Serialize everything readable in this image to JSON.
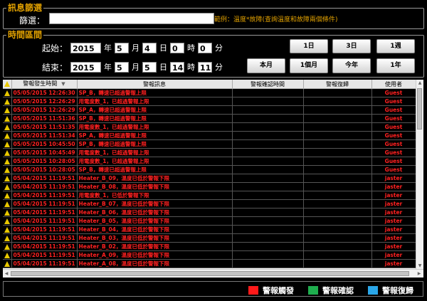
{
  "filter": {
    "title": "訊息篩選",
    "label": "篩選：",
    "value": "",
    "hint": "範例：溫度*故障(查詢溫度和故障兩個條件)"
  },
  "time": {
    "title": "時間區間",
    "start": {
      "label": "起始：",
      "year": "2015",
      "month": "5",
      "day": "4",
      "hour": "0",
      "minute": "0"
    },
    "end": {
      "label": "結束：",
      "year": "2015",
      "month": "5",
      "day": "5",
      "hour": "14",
      "minute": "11"
    },
    "units": {
      "year": "年",
      "month": "月",
      "day": "日",
      "hour": "時",
      "minute": "分"
    },
    "buttons": [
      "1日",
      "3日",
      "1週",
      "本月",
      "1個月",
      "今年",
      "1年"
    ]
  },
  "table": {
    "columns": [
      "",
      "警報發生時間",
      "警報訊息",
      "警報確認時間",
      "警報復歸",
      "使用者"
    ],
    "rows": [
      [
        "05/05/2015 12:26:30",
        "SP_B，轉速已超過警報上限",
        "",
        "",
        "Guest"
      ],
      [
        "05/05/2015 12:26:29",
        "用電度數_1，已超過警報上限",
        "",
        "",
        "Guest"
      ],
      [
        "05/05/2015 12:26:29",
        "SP_A，轉速已超過警報上限",
        "",
        "",
        "Guest"
      ],
      [
        "05/05/2015 11:51:36",
        "SP_B，轉速已超過警報上限",
        "",
        "",
        "Guest"
      ],
      [
        "05/05/2015 11:51:35",
        "用電度數_1，已超過警報上限",
        "",
        "",
        "Guest"
      ],
      [
        "05/05/2015 11:51:34",
        "SP_A，轉速已超過警報上限",
        "",
        "",
        "Guest"
      ],
      [
        "05/05/2015 10:45:50",
        "SP_B，轉速已超過警報上限",
        "",
        "",
        "Guest"
      ],
      [
        "05/05/2015 10:45:49",
        "用電度數_1，已超過警報上限",
        "",
        "",
        "Guest"
      ],
      [
        "05/05/2015 10:28:05",
        "用電度數_1，已超過警報上限",
        "",
        "",
        "Guest"
      ],
      [
        "05/05/2015 10:28:05",
        "SP_B，轉速已超過警報上限",
        "",
        "",
        "Guest"
      ],
      [
        "05/04/2015 11:19:51",
        "Heater_B_09，溫度已低於警報下限",
        "",
        "",
        "jaster"
      ],
      [
        "05/04/2015 11:19:51",
        "Heater_B_08，溫度已低於警報下限",
        "",
        "",
        "jaster"
      ],
      [
        "05/04/2015 11:19:51",
        "用電度數_1，已低於警報下限",
        "",
        "",
        "jaster"
      ],
      [
        "05/04/2015 11:19:51",
        "Heater_B_07，溫度已低於警報下限",
        "",
        "",
        "jaster"
      ],
      [
        "05/04/2015 11:19:51",
        "Heater_B_06，溫度已低於警報下限",
        "",
        "",
        "jaster"
      ],
      [
        "05/04/2015 11:19:51",
        "Heater_B_05，溫度已低於警報下限",
        "",
        "",
        "jaster"
      ],
      [
        "05/04/2015 11:19:51",
        "Heater_B_04，溫度已低於警報下限",
        "",
        "",
        "jaster"
      ],
      [
        "05/04/2015 11:19:51",
        "Heater_B_03，溫度已低於警報下限",
        "",
        "",
        "jaster"
      ],
      [
        "05/04/2015 11:19:51",
        "Heater_B_02，溫度已低於警報下限",
        "",
        "",
        "jaster"
      ],
      [
        "05/04/2015 11:19:51",
        "Heater_A_09，溫度已低於警報下限",
        "",
        "",
        "jaster"
      ],
      [
        "05/04/2015 11:19:51",
        "Heater_A_08，溫度已低於警報下限",
        "",
        "",
        "jaster"
      ]
    ]
  },
  "legend": [
    {
      "label": "警報觸發",
      "color": "#ff1a1a"
    },
    {
      "label": "警報確認",
      "color": "#1fae4e"
    },
    {
      "label": "警報復歸",
      "color": "#2aa6e8"
    }
  ],
  "colors": {
    "alarm_text": "#ff2020",
    "section_title": "#e0a000",
    "warning_icon": "#e8c800"
  },
  "icons": {
    "row_status": "warning-triangle-icon"
  }
}
